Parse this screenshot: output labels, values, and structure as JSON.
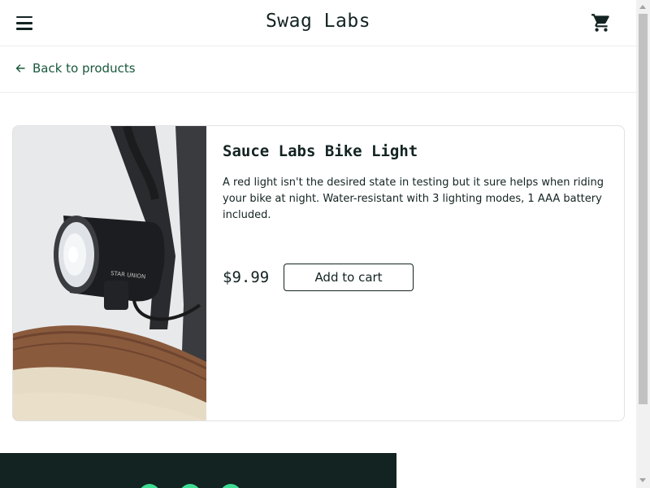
{
  "header": {
    "title": "Swag Labs",
    "menu_icon": "hamburger-menu-icon",
    "cart_icon": "shopping-cart-icon"
  },
  "subheader": {
    "back_label": "Back to products",
    "back_icon": "arrow-left-icon"
  },
  "product": {
    "name": "Sauce Labs Bike Light",
    "description": "A red light isn't the desired state in testing but it sure helps when riding your bike at night. Water-resistant with 3 lighting modes, 1 AAA battery included.",
    "price": "$9.99",
    "add_to_cart_label": "Add to cart",
    "image_alt": "Sauce Labs Bike Light",
    "image_brand_text": "STAR UNION"
  },
  "colors": {
    "text": "#132322",
    "link": "#18583a",
    "footer_bg": "#132322",
    "social_accent": "#3ddc91"
  }
}
